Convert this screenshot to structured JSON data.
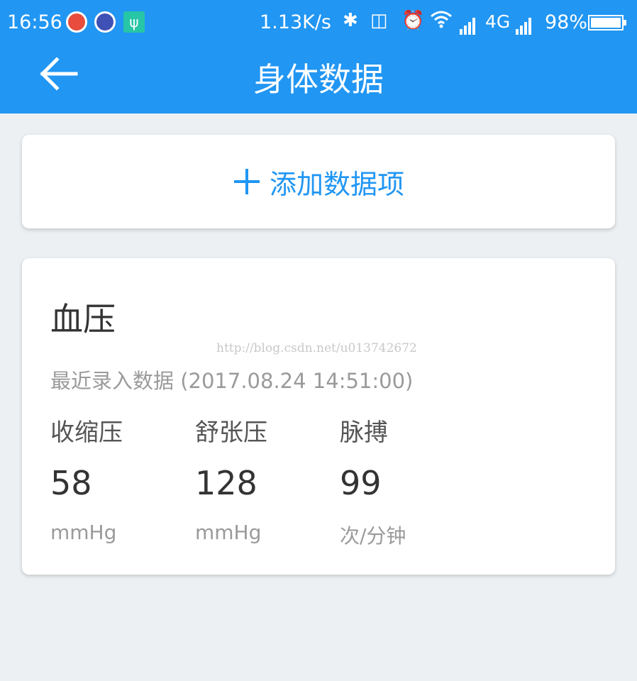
{
  "status_bar": {
    "time": "16:56",
    "net_speed": "1.13K/s",
    "network": "4G",
    "battery": "98%"
  },
  "header": {
    "title": "身体数据"
  },
  "add_item": {
    "label": "添加数据项"
  },
  "watermark": "http://blog.csdn.net/u013742672",
  "blood_pressure": {
    "title": "血压",
    "recent_label": "最近录入数据 (2017.08.24 14:51:00)",
    "metrics": [
      {
        "label": "收缩压",
        "value": "58",
        "unit": "mmHg"
      },
      {
        "label": "舒张压",
        "value": "128",
        "unit": "mmHg"
      },
      {
        "label": "脉搏",
        "value": "99",
        "unit": "次/分钟"
      }
    ]
  },
  "colors": {
    "primary": "#2196f3",
    "background": "#ecf0f3"
  }
}
